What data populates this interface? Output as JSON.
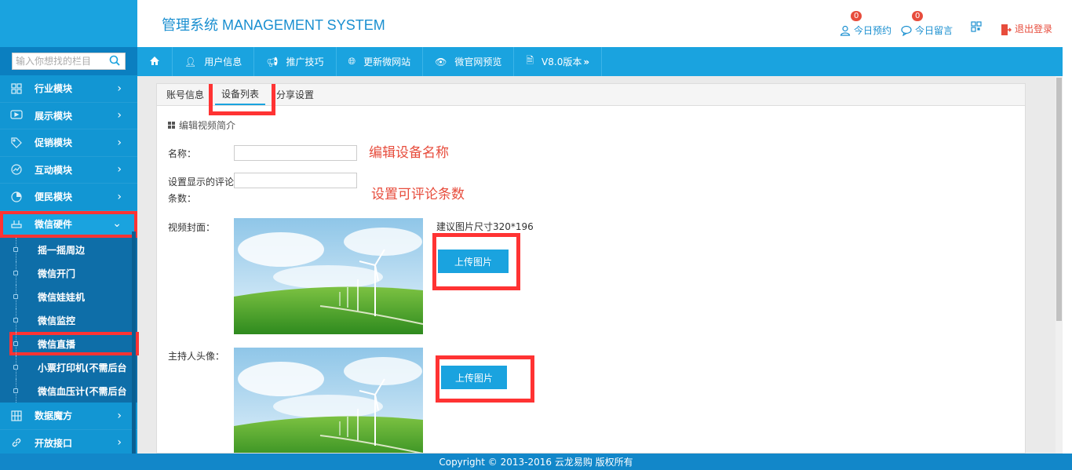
{
  "colors": {
    "brand": "#1aa3df",
    "sidebar": "#0b7fc0",
    "annotation": "#e74c3c"
  },
  "sidebar": {
    "search_placeholder": "输入你想找的栏目",
    "menu": [
      {
        "label": "行业模块",
        "icon": "grid-icon"
      },
      {
        "label": "展示模块",
        "icon": "play-icon"
      },
      {
        "label": "促销模块",
        "icon": "tag-icon"
      },
      {
        "label": "互动模块",
        "icon": "chart-icon"
      },
      {
        "label": "便民模块",
        "icon": "pie-icon"
      },
      {
        "label": "微信硬件",
        "icon": "router-icon"
      }
    ],
    "submenu": [
      "摇一摇周边",
      "微信开门",
      "微信娃娃机",
      "微信监控",
      "微信直播",
      "小票打印机(不需后台",
      "微信血压计(不需后台"
    ],
    "menu_bottom": [
      {
        "label": "数据魔方",
        "icon": "cube-icon"
      },
      {
        "label": "开放接口",
        "icon": "link-icon"
      }
    ]
  },
  "header": {
    "title": "管理系统 MANAGEMENT SYSTEM",
    "appointments": {
      "label": "今日预约",
      "count": "0"
    },
    "messages": {
      "label": "今日留言",
      "count": "0"
    },
    "logout": "退出登录"
  },
  "topnav": [
    "用户信息",
    "推广技巧",
    "更新微网站",
    "微官网预览",
    "V8.0版本"
  ],
  "tabs": [
    "账号信息",
    "设备列表",
    "分享设置"
  ],
  "form": {
    "section_title": "编辑视频简介",
    "name_label": "名称：",
    "comments_label_1": "设置显示的评论",
    "comments_label_2": "条数：",
    "cover_label": "视频封面：",
    "avatar_label": "主持人头像：",
    "size_hint": "建议图片尺寸320*196",
    "upload_label": "上传图片",
    "name_value": "",
    "comments_value": ""
  },
  "annotations": {
    "name_note": "编辑设备名称",
    "comments_note": "设置可评论条数"
  },
  "footer": "Copyright © 2013-2016   云龙易购 版权所有"
}
